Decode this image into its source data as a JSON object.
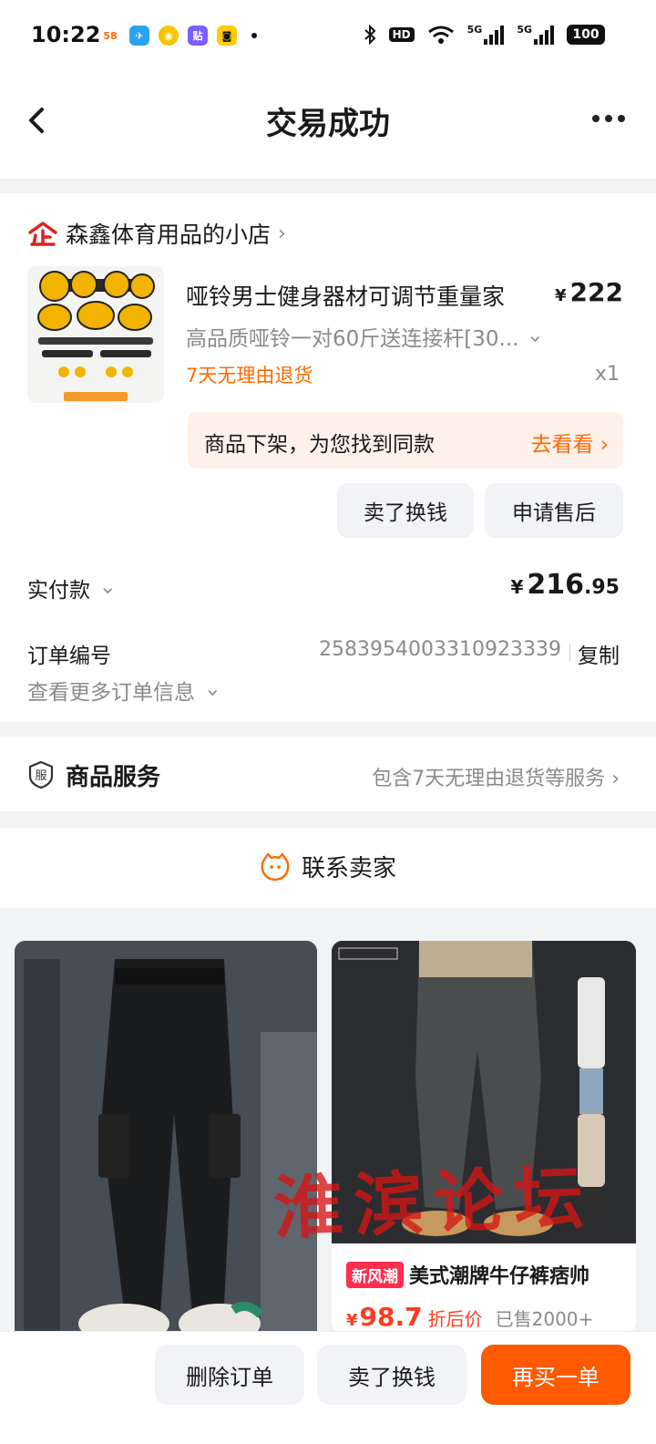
{
  "status_bar": {
    "time": "10:22",
    "app_icons": [
      "58-app-icon",
      "send-icon",
      "bean-app-icon",
      "tie-app-icon",
      "bag-app-icon"
    ],
    "app_icon_labels": [
      "58",
      "✈",
      "◉",
      "贴",
      "◙"
    ],
    "hd_label": "HD",
    "signal_1": "5G",
    "signal_2": "5G",
    "battery": "100"
  },
  "nav": {
    "title": "交易成功"
  },
  "order": {
    "shop_name": "森鑫体育用品的小店",
    "product": {
      "title": "哑铃男士健身器材可调节重量家",
      "price": "222",
      "currency": "¥",
      "sku": "高品质哑铃一对60斤送连接杆[30...",
      "return_policy": "7天无理由退货",
      "quantity": "x1"
    },
    "similar_banner": {
      "message": "商品下架，为您找到同款",
      "link": "去看看"
    },
    "buttons": {
      "sell": "卖了换钱",
      "aftersale": "申请售后"
    },
    "payment": {
      "label": "实付款",
      "currency": "¥",
      "amount_int": "216",
      "amount_dec": ".95"
    },
    "order_number": {
      "label": "订单编号",
      "value": "2583954003310923339",
      "copy": "复制"
    },
    "more_info": "查看更多订单信息"
  },
  "service": {
    "title": "商品服务",
    "desc": "包含7天无理由退货等服务",
    "icon_char": "服"
  },
  "contact": {
    "label": "联系卖家"
  },
  "recommendations": [
    {
      "tag": "新风潮",
      "title": "美式潮牌牛仔裤痞帅",
      "currency": "¥",
      "price": "98.7",
      "discount_label": "折后价",
      "sold": "已售2000+"
    }
  ],
  "watermark": "淮滨论坛",
  "bottom_bar": {
    "delete": "删除订单",
    "sell": "卖了换钱",
    "rebuy": "再买一单"
  },
  "colors": {
    "accent": "#ff5a00",
    "price_red": "#ff3b1f",
    "shop_red": "#e02020",
    "banner_bg": "#fdf1ea"
  }
}
